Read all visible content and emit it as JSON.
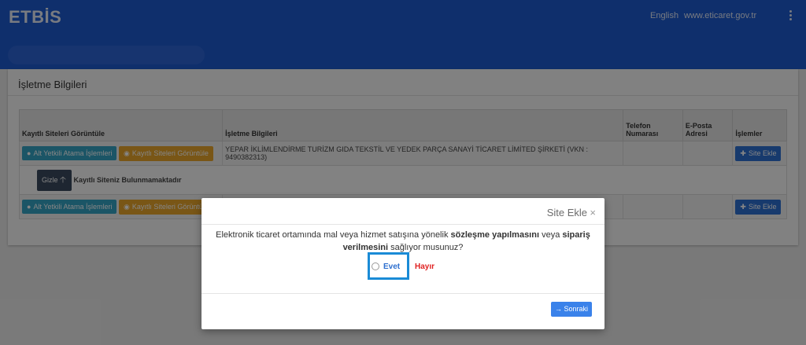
{
  "header": {
    "brand": "ETBİS",
    "lang": "English",
    "site": "www.eticaret.gov.tr",
    "menu_icon": "more-vertical-icon",
    "color": "#1e5bd0"
  },
  "card": {
    "title": "İşletme Bilgileri"
  },
  "table": {
    "headers": [
      "Kayıtlı Siteleri Görüntüle",
      "İşletme Bilgileri",
      "Telefon Numarası",
      "E-Posta Adresi",
      "İşlemler"
    ],
    "row1": {
      "btn_assign": "Alt Yetkili Atama İşlemleri",
      "btn_view": "Kayıtlı Siteleri Görüntüle",
      "company": "YEPAR İKLİMLENDİRME TURİZM GIDA TEKSTİL VE YEDEK PARÇA SANAYİ TİCARET LİMİTED ŞİRKETİ (VKN : 9490382313)",
      "btn_add": "Site Ekle"
    },
    "subrow": {
      "btn_hide": "Gizle",
      "message": "Kayıtlı Siteniz Bulunmamaktadır"
    },
    "row2": {
      "btn_assign": "Alt Yetkili Atama İşlemleri",
      "btn_view": "Kayıtlı Siteleri Görüntüle",
      "btn_add": "Site Ekle"
    }
  },
  "modal": {
    "title": "Site Ekle",
    "close": "×",
    "q_part1": "Elektronik ticaret ortamında mal veya hizmet satışına yönelik ",
    "q_bold1": "sözleşme yapılmasını",
    "q_part2": " veya ",
    "q_bold2": "sipariş verilmesini",
    "q_part3": " sağlıyor musunuz?",
    "yes": "Evet",
    "no": "Hayır",
    "next": "Sonraki"
  },
  "colors": {
    "teal": "#35a3c4",
    "orange": "#e8a52b",
    "blue": "#2c6fd2",
    "no_red": "#e02020",
    "highlight": "#1a8bd6"
  }
}
